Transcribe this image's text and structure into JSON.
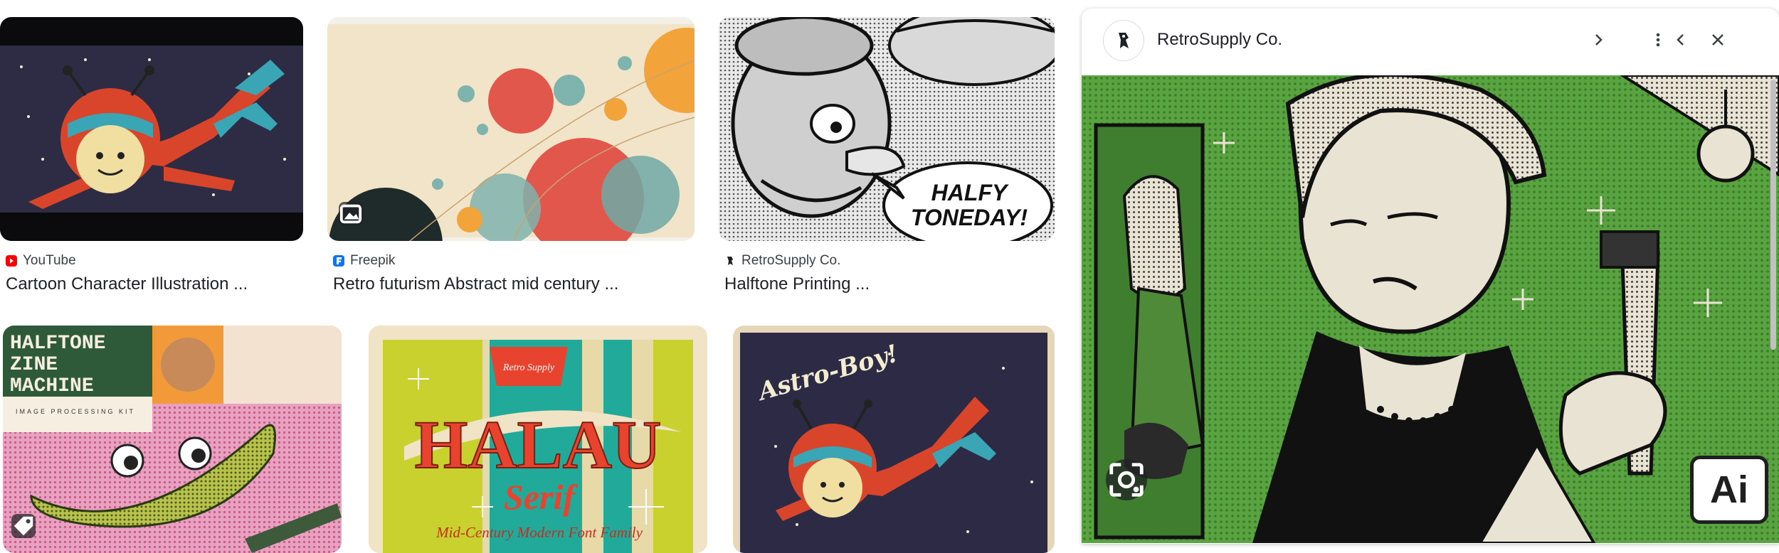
{
  "results": [
    {
      "source": "YouTube",
      "title": "Cartoon Character Illustration ...",
      "favicon_color": "#ff0000"
    },
    {
      "source": "Freepik",
      "title": "Retro futurism Abstract mid century ...",
      "favicon_color": "#1273eb"
    },
    {
      "source": "RetroSupply Co.",
      "title": "Halftone Printing ...",
      "favicon_color": "#202124"
    }
  ],
  "row2_images": [
    {
      "label": "Halftone Zine Machine collage"
    },
    {
      "label": "Halau Serif font poster"
    },
    {
      "label": "Astro-Boy illustration"
    }
  ],
  "thumb_texts": {
    "halfy_line1": "HALFY",
    "halfy_line2": "TONEDAY!",
    "zine_line1": "HALFTONE",
    "zine_line2": "ZINE",
    "zine_line3": "MACHINE",
    "zine_caption": "IMAGE PROCESSING KIT",
    "halau_word": "HALAU",
    "halau_serif": "Serif",
    "halau_sub": "Mid-Century Modern Font Family",
    "halau_badge": "Retro Supply",
    "astro_script": "Astro-Boy!"
  },
  "panel": {
    "title": "RetroSupply Co.",
    "ai_badge": "Ai",
    "buttons": {
      "prev": "previous",
      "next": "next",
      "more": "more options",
      "close": "close"
    }
  }
}
